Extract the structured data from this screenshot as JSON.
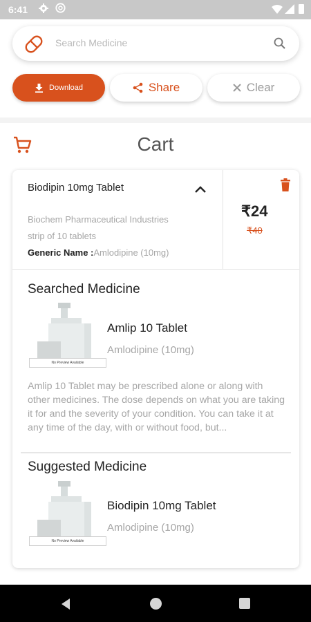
{
  "status_bar": {
    "time": "6:41"
  },
  "search": {
    "placeholder": "Search Medicine"
  },
  "actions": {
    "download_label": "Download",
    "share_label": "Share",
    "clear_label": "Clear"
  },
  "page": {
    "title": "Cart"
  },
  "cart_item": {
    "name": "Biodipin 10mg Tablet",
    "company": "Biochem Pharmaceutical Industries",
    "pack": "strip of 10 tablets",
    "generic_label": "Generic Name :",
    "generic_value": "Amlodipine (10mg)",
    "price": "₹24",
    "mrp": "₹40"
  },
  "searched": {
    "title": "Searched Medicine",
    "name": "Amlip 10 Tablet",
    "generic": "Amlodipine (10mg)",
    "preview_text": "No Preview Available",
    "description": "Amlip 10 Tablet may be prescribed alone or along with other medicines. The dose depends on what you are taking it for and the severity of your condition. You can take it at any time of the day, with or without food, but..."
  },
  "suggested": {
    "title": "Suggested Medicine",
    "name": "Biodipin 10mg Tablet",
    "generic": "Amlodipine (10mg)",
    "preview_text": "No Preview Available"
  },
  "colors": {
    "accent": "#d8511d",
    "status_bar": "#c8c8c8",
    "muted_text": "#a6a6a6"
  },
  "icons": [
    "gear-icon",
    "at-icon",
    "wifi-icon",
    "signal-icon",
    "battery-icon",
    "pill-icon",
    "search-icon",
    "download-icon",
    "share-icon",
    "close-icon",
    "cart-icon",
    "chevron-up-icon",
    "trash-icon",
    "back-icon",
    "home-icon",
    "recents-icon"
  ]
}
